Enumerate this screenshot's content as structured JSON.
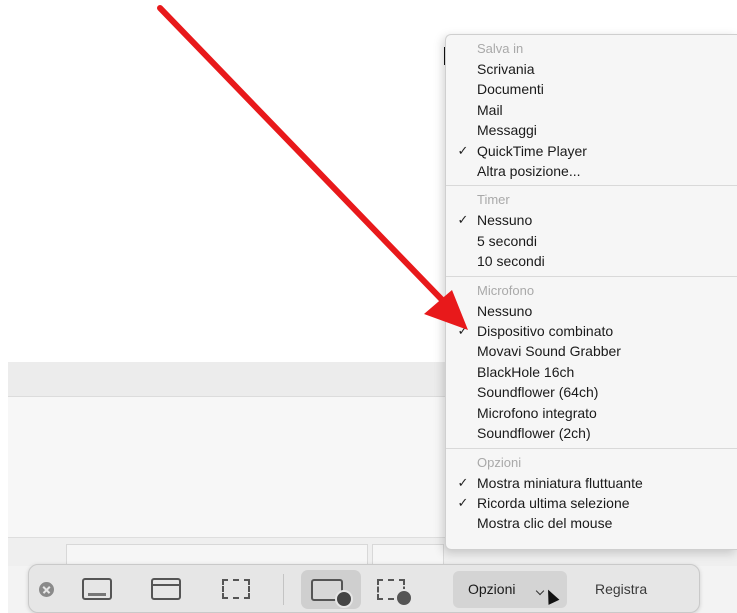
{
  "menu": {
    "sections": [
      {
        "header": "Salva in",
        "items": [
          {
            "label": "Scrivania",
            "checked": false
          },
          {
            "label": "Documenti",
            "checked": false
          },
          {
            "label": "Mail",
            "checked": false
          },
          {
            "label": "Messaggi",
            "checked": false
          },
          {
            "label": "QuickTime Player",
            "checked": true
          },
          {
            "label": "Altra posizione...",
            "checked": false
          }
        ]
      },
      {
        "header": "Timer",
        "items": [
          {
            "label": "Nessuno",
            "checked": true
          },
          {
            "label": "5 secondi",
            "checked": false
          },
          {
            "label": "10 secondi",
            "checked": false
          }
        ]
      },
      {
        "header": "Microfono",
        "items": [
          {
            "label": "Nessuno",
            "checked": false
          },
          {
            "label": "Dispositivo combinato",
            "checked": true
          },
          {
            "label": "Movavi Sound Grabber",
            "checked": false
          },
          {
            "label": "BlackHole 16ch",
            "checked": false
          },
          {
            "label": "Soundflower (64ch)",
            "checked": false
          },
          {
            "label": "Microfono integrato",
            "checked": false
          },
          {
            "label": "Soundflower (2ch)",
            "checked": false
          }
        ]
      },
      {
        "header": "Opzioni",
        "items": [
          {
            "label": "Mostra miniatura fluttuante",
            "checked": true
          },
          {
            "label": "Ricorda ultima selezione",
            "checked": true
          },
          {
            "label": "Mostra clic del mouse",
            "checked": false
          }
        ]
      }
    ],
    "check_glyph": "✓"
  },
  "toolbar": {
    "options_label": "Opzioni",
    "record_label": "Registra"
  },
  "icons": {
    "close": "close-icon",
    "capture_full": "capture-entire-screen-icon",
    "capture_window": "capture-window-icon",
    "capture_selection": "capture-selection-icon",
    "record_screen": "record-entire-screen-icon",
    "record_selection": "record-selection-icon",
    "chevron": "chevron-down-icon",
    "cursor": "mouse-pointer-icon"
  },
  "colors": {
    "annotation_arrow": "#e8191b",
    "menu_background": "#f6f6f6",
    "toolbar_background": "#e6e6e6"
  }
}
